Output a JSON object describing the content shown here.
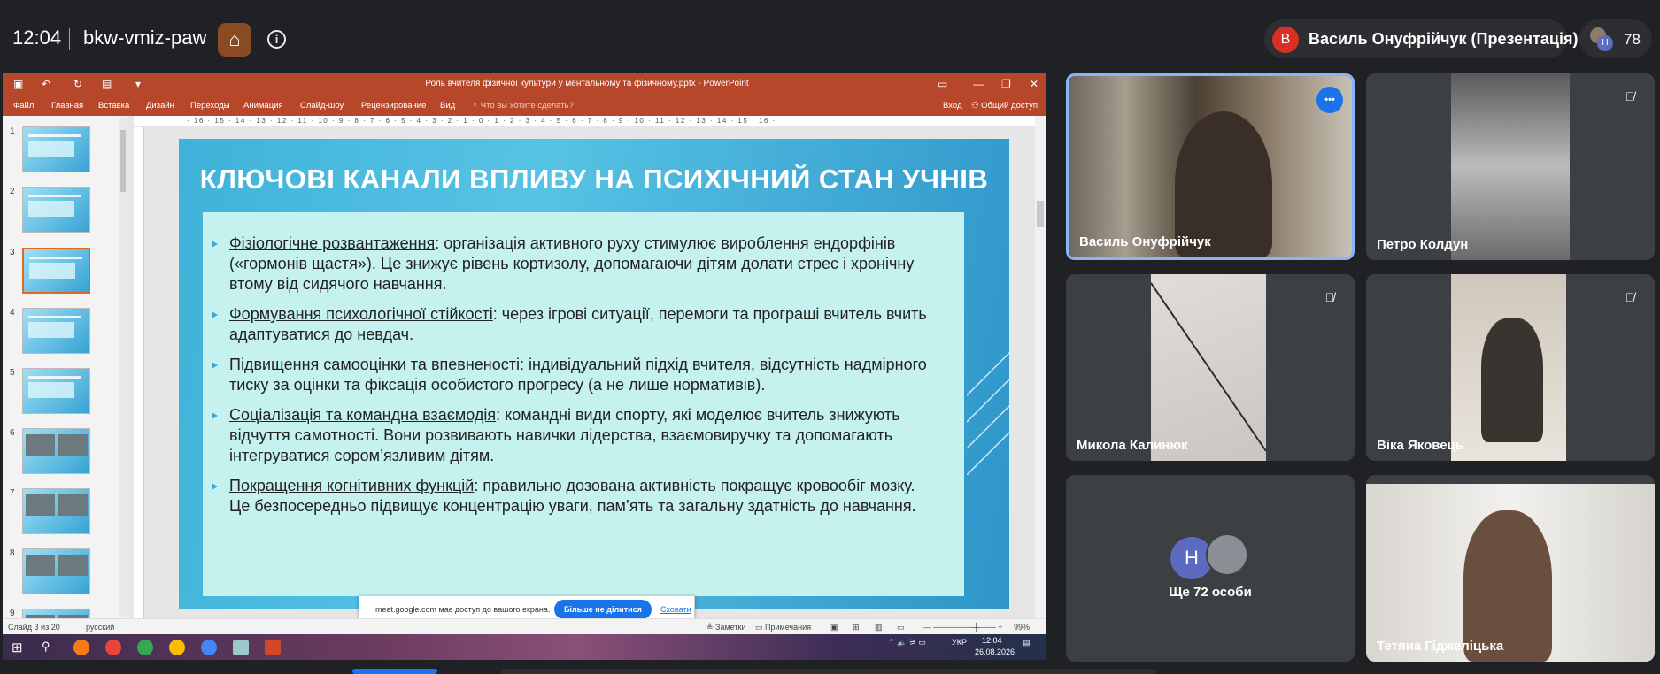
{
  "meet": {
    "time": "12:04",
    "code": "bkw-vmiz-paw",
    "presenter_initial": "В",
    "presenter_label": "Василь Онуфрійчук (Презентація)",
    "participant_count": "78",
    "count_avatar_initial": "Н"
  },
  "powerpoint": {
    "window_title": "Роль вчителя фізичної культури у ментальному та фізичному.pptx - PowerPoint",
    "ribbon_tabs": [
      "Файл",
      "Главная",
      "Вставка",
      "Дизайн",
      "Переходы",
      "Анимация",
      "Слайд-шоу",
      "Рецензирование",
      "Вид"
    ],
    "tell_me": "Что вы хотите сделать?",
    "sign_in": "Вход",
    "share": "Общий доступ",
    "ruler_h": "· 16 · 15 · 14 · 13 · 12 · 11 · 10 · 9 · 8 · 7 · 6 · 5 · 4 · 3 · 2 · 1 · 0 · 1 · 2 · 3 · 4 · 5 · 6 · 7 · 8 · 9 · 10 · 11 · 12 · 13 · 14 · 15 · 16 ·",
    "thumb_numbers": [
      "1",
      "2",
      "3",
      "4",
      "5",
      "6",
      "7",
      "8",
      "9"
    ],
    "slide": {
      "title": "КЛЮЧОВІ КАНАЛИ ВПЛИВУ НА ПСИХІЧНИЙ СТАН УЧНІВ",
      "bullets": [
        {
          "head": "Фізіологічне розвантаження",
          "body": ": організація активного руху стимулює вироблення ендорфінів («гормонів щастя»). Це знижує рівень кортизолу, допомагаючи дітям долати стрес і хронічну втому від сидячого навчання."
        },
        {
          "head": "Формування психологічної стійкості",
          "body": ": через ігрові ситуації, перемоги та програші вчитель вчить адаптуватися до невдач."
        },
        {
          "head": "Підвищення самооцінки та впевненості",
          "body": ": індивідуальний підхід вчителя, відсутність надмірного тиску за оцінки та фіксація особистого прогресу (а не лише нормативів)."
        },
        {
          "head": "Соціалізація та командна взаємодія",
          "body": ": командні види спорту, які моделює вчитель знижують відчуття самотності. Вони розвивають навички лідерства, взаємовиручку та допомагають інтегруватися сором’язливим дітям."
        },
        {
          "head": "Покращення когнітивних функцій",
          "body": ": правильно дозована активність покращує кровообіг мозку. Це безпосередньо підвищує концентрацію уваги, пам’ять та загальну здатність до навчання."
        }
      ]
    },
    "status": {
      "slide_of": "Слайд 3 из 20",
      "language": "русский",
      "notes": "Заметки",
      "comments": "Примечания",
      "zoom": "99%"
    },
    "share_bar": {
      "text": "meet.google.com має доступ до вашого екрана.",
      "stop": "Більше не ділитися",
      "hide": "Сховати"
    },
    "taskbar": {
      "lang": "УКР",
      "time": "12:04",
      "date": "26.08.2026"
    }
  },
  "participants": [
    {
      "name": "Василь Онуфрійчук",
      "state": "speaking"
    },
    {
      "name": "Петро Колдун",
      "state": "muted"
    },
    {
      "name": "Микола Калинюк",
      "state": "muted"
    },
    {
      "name": "Віка Яковець",
      "state": "muted"
    },
    {
      "name": "Тетяна Гіджеліцька",
      "state": "video"
    }
  ],
  "more": {
    "initial": "Н",
    "label": "Ще 72 особи"
  },
  "colors": {
    "meet_bg": "#202124",
    "tile_bg": "#3c4043",
    "pp_accent": "#b7472a",
    "active_border": "#8ab4f8",
    "meet_blue": "#1a73e8"
  }
}
